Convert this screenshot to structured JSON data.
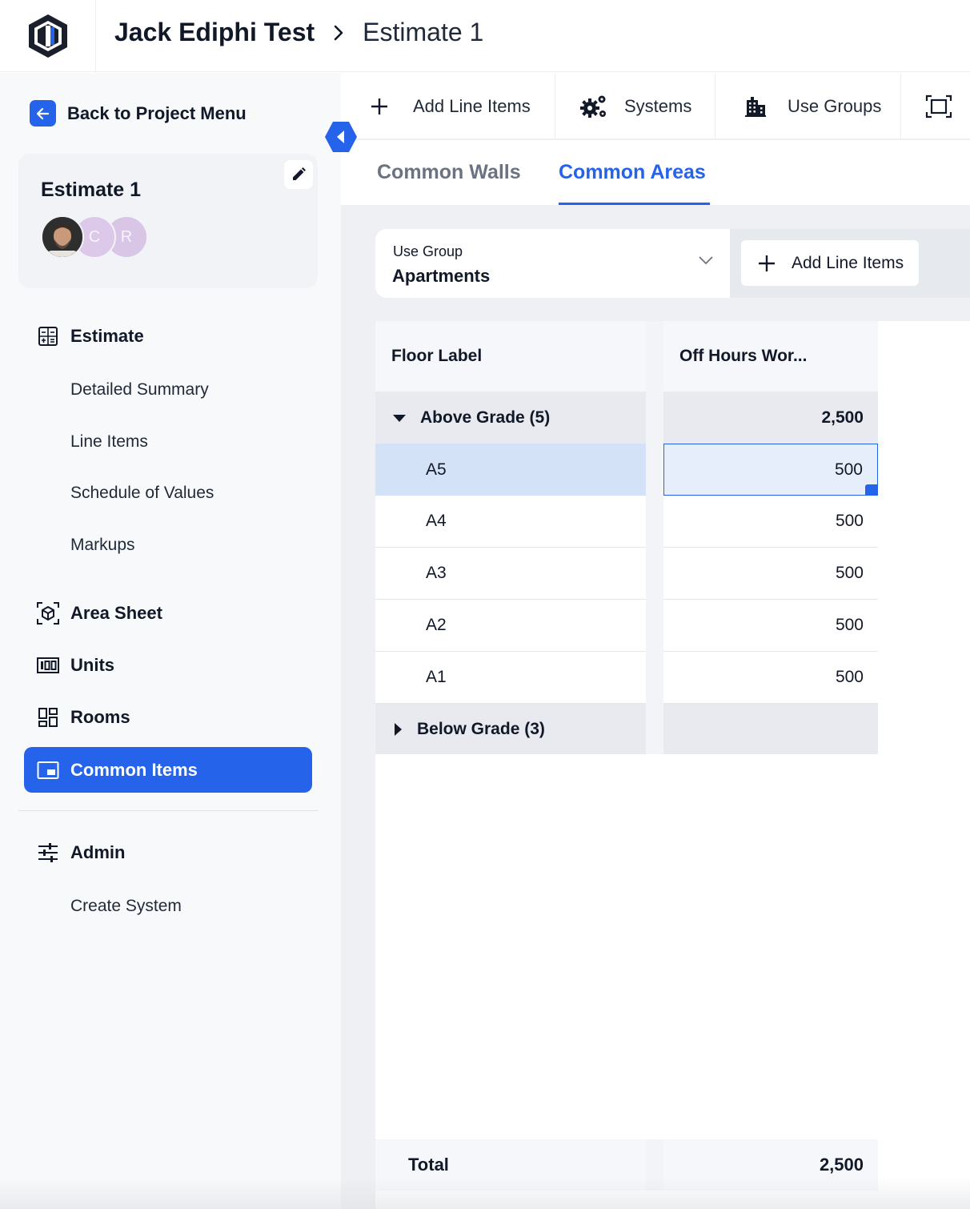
{
  "header": {
    "project_name": "Jack Ediphi Test",
    "current_page": "Estimate 1"
  },
  "sidebar": {
    "back_label": "Back to Project Menu",
    "estimate_card": {
      "title": "Estimate 1",
      "avatars": [
        "C",
        "R"
      ]
    },
    "sections": {
      "estimate": "Estimate",
      "estimate_items": [
        "Detailed Summary",
        "Line Items",
        "Schedule of Values",
        "Markups"
      ],
      "area_sheet": "Area Sheet",
      "units": "Units",
      "rooms": "Rooms",
      "common_items": "Common Items",
      "admin": "Admin",
      "admin_items": [
        "Create System"
      ]
    }
  },
  "toolbar": {
    "add_line_items": "Add Line Items",
    "systems": "Systems",
    "use_groups": "Use Groups"
  },
  "tabs": {
    "common_walls": "Common Walls",
    "common_areas": "Common Areas"
  },
  "filter": {
    "use_group_label": "Use Group",
    "use_group_value": "Apartments",
    "add_line_items": "Add Line Items"
  },
  "grid": {
    "columns": [
      "Floor Label",
      "Off Hours Wor..."
    ],
    "groups": [
      {
        "label": "Above Grade (5)",
        "total": "2,500",
        "expanded": true,
        "rows": [
          {
            "floor": "A5",
            "value": "500"
          },
          {
            "floor": "A4",
            "value": "500"
          },
          {
            "floor": "A3",
            "value": "500"
          },
          {
            "floor": "A2",
            "value": "500"
          },
          {
            "floor": "A1",
            "value": "500"
          }
        ]
      },
      {
        "label": "Below Grade (3)",
        "total": "",
        "expanded": false
      }
    ],
    "total_label": "Total",
    "total_value": "2,500"
  },
  "colors": {
    "accent": "#2563eb",
    "selected_row": "#d4e2f8"
  }
}
